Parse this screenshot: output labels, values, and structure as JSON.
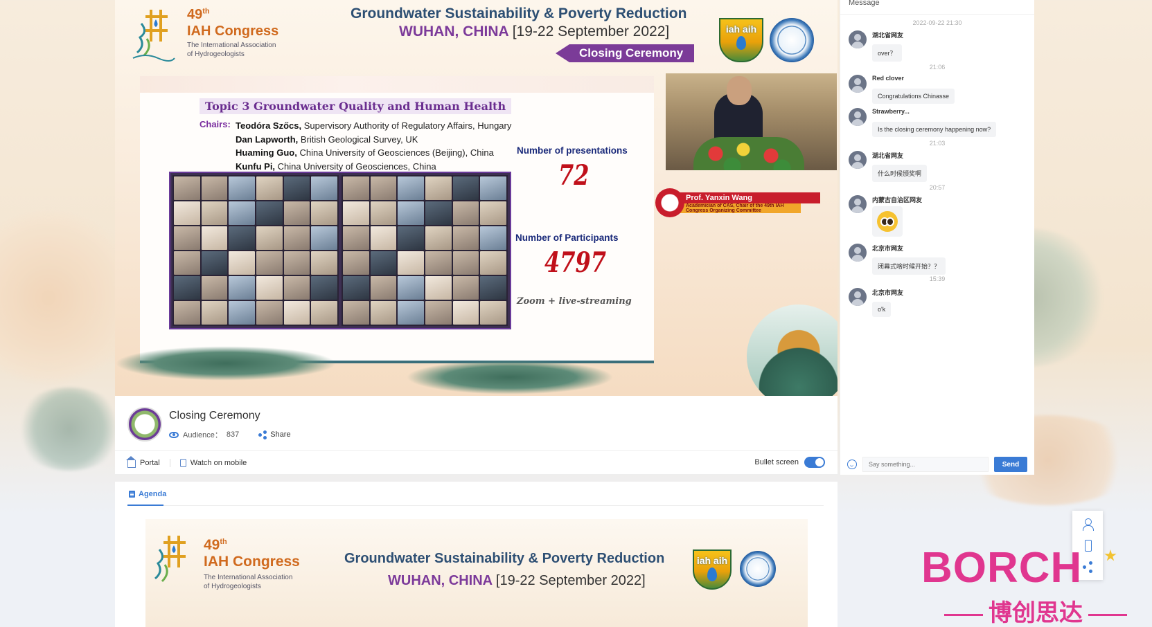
{
  "video": {
    "congress_number": "49",
    "congress_number_suffix": "th",
    "congress_name": "IAH Congress",
    "congress_assoc_line1": "The International Association",
    "congress_assoc_line2": "of Hydrogeologists",
    "headline": "Groundwater Sustainability & Poverty Reduction",
    "location": "WUHAN, CHINA",
    "dates": "[19-22 September 2022]",
    "ribbon": "Closing Ceremony",
    "iah_logo_text": "iah aih",
    "slide": {
      "topic": "Topic 3   Groundwater Quality and Human Health",
      "chairs_label": "Chairs:",
      "chairs": [
        {
          "name": "Teodóra Szőcs,",
          "affil": " Supervisory Authority of Regulatory Affairs, Hungary"
        },
        {
          "name": "Dan Lapworth,",
          "affil": " British Geological Survey, UK"
        },
        {
          "name": "Huaming Guo,",
          "affil": " China University of Geosciences (Beijing), China"
        },
        {
          "name": "Kunfu Pi,",
          "affil": " China University of Geosciences, China"
        }
      ],
      "presentations_label": "Number of presentations",
      "presentations_value": "72",
      "participants_label": "Number of Participants",
      "participants_value": "4797",
      "note": "Zoom + live-streaming"
    },
    "speaker_name": "Prof. Yanxin Wang",
    "speaker_title": "Academician of CAS, Chair of the 49th IAH Congress Organizing Committee"
  },
  "info": {
    "title": "Closing Ceremony",
    "audience_label": "Audience：",
    "audience_count": "837",
    "share_label": "Share",
    "portal_label": "Portal",
    "mobile_label": "Watch on mobile",
    "bullet_label": "Bullet screen",
    "bullet_on": true
  },
  "agenda": {
    "tab_label": "Agenda"
  },
  "chat": {
    "header": "Message",
    "messages": [
      {
        "time": "2022-09-22 21:30",
        "user": "湖北省网友",
        "text": "over？"
      },
      {
        "time": "21:06",
        "user": "Red clover",
        "text": "Congratulations Chinasse"
      },
      {
        "time": "",
        "user": "Strawberry...",
        "text": "Is the closing ceremony happening now?"
      },
      {
        "time": "21:03",
        "user": "湖北省网友",
        "text": "什么时候颁奖啊"
      },
      {
        "time": "20:57",
        "user": "内蒙古自治区网友",
        "text": "",
        "emoji": "grin-emoji"
      },
      {
        "time": "",
        "user": "北京市网友",
        "text": "闭幕式啥时候开始？？"
      },
      {
        "time": "15:39",
        "user": "北京市网友",
        "text": "o'k"
      }
    ],
    "input_placeholder": "Say something...",
    "send_label": "Send"
  },
  "watermark": {
    "brand": "BORCH",
    "chinese": "博创思达"
  },
  "colors": {
    "accent": "#3a7bd5",
    "purple": "#7c3a9a",
    "orange": "#d06a1e",
    "stat_red": "#c0101a",
    "brand_pink": "#e0368f"
  }
}
